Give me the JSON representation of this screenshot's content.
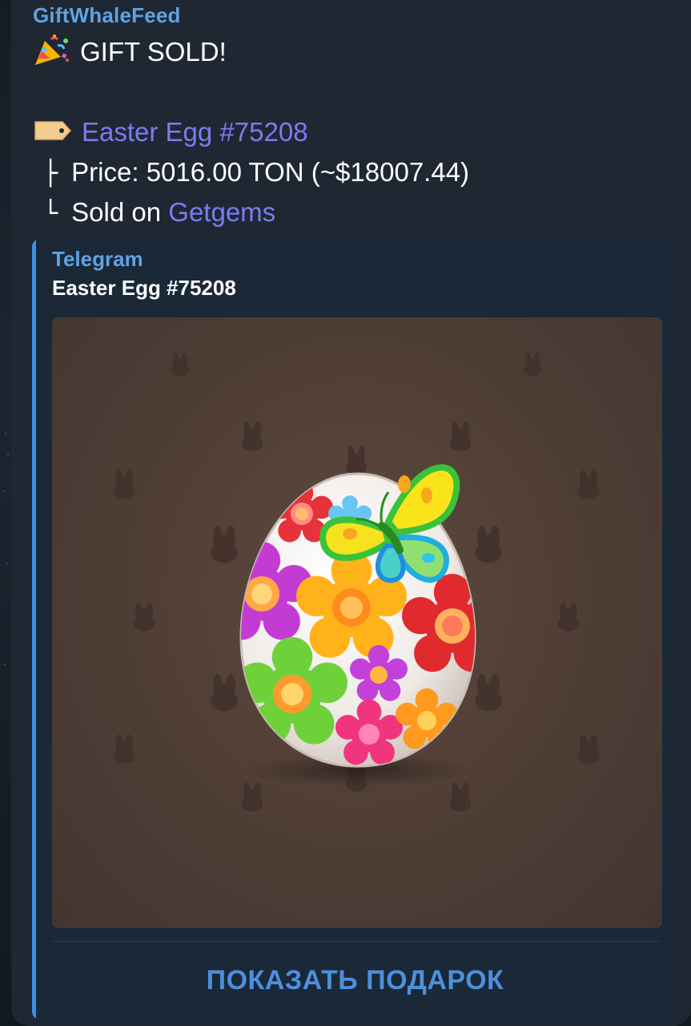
{
  "message": {
    "sender": "GiftWhaleFeed",
    "title_icon": "party-popper-icon",
    "title": "GIFT SOLD!",
    "item_icon": "label-tag-icon",
    "item_name": "Easter Egg #75208",
    "price_prefix": "├",
    "price_label": "Price:",
    "price_value": "5016.00 TON (~$18007.44)",
    "sold_prefix": "└",
    "sold_label": "Sold on",
    "sold_link": "Getgems"
  },
  "link_preview": {
    "site_name": "Telegram",
    "title": "Easter Egg #75208",
    "image": "easter-egg-gift-image",
    "button_label": "ПОКАЗАТЬ ПОДАРОК"
  },
  "colors": {
    "accent": "#5fa2e3",
    "link": "#7c7cf0",
    "bubble": "#1f2733",
    "preview_bg": "#1a2838",
    "gift_backdrop": "#4e3d35"
  }
}
